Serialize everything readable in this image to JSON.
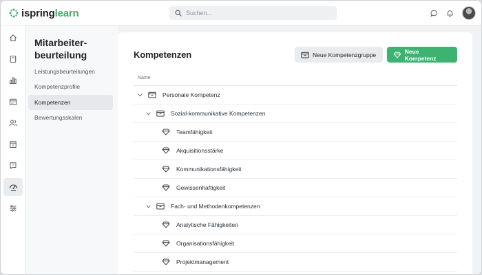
{
  "app": {
    "logo_text": "ispring",
    "logo_accent": "learn",
    "brand_color": "#3dae6b"
  },
  "search": {
    "placeholder": "Suchen..."
  },
  "topbar": {
    "icons": [
      "chat-icon",
      "bell-icon"
    ]
  },
  "rail": {
    "items": [
      {
        "icon": "home-icon"
      },
      {
        "icon": "book-icon"
      },
      {
        "icon": "bar-chart-icon"
      },
      {
        "icon": "calendar-icon"
      },
      {
        "icon": "users-icon"
      },
      {
        "icon": "calendar-day-icon"
      },
      {
        "icon": "help-chat-icon"
      },
      {
        "icon": "performance-review-icon",
        "active": true
      },
      {
        "icon": "settings-sliders-icon"
      }
    ]
  },
  "sidebar": {
    "title": "Mitarbeiter-beurteilung",
    "items": [
      {
        "label": "Leistungsbeurteilungen"
      },
      {
        "label": "Kompetenzprofile"
      },
      {
        "label": "Kompetenzen",
        "active": true
      },
      {
        "label": "Bewertungsskalen"
      }
    ]
  },
  "main": {
    "title": "Kompetenzen",
    "btn_new_group": "Neue Kompetenzgruppe",
    "btn_new_competency": "Neue Kompetenz",
    "column_name": "Name",
    "tree": [
      {
        "label": "Personale Kompetenz",
        "type": "group",
        "level": 0,
        "expanded": true
      },
      {
        "label": "Sozial-kommunikative Kompetenzen",
        "type": "group",
        "level": 1,
        "expanded": true
      },
      {
        "label": "Teamfähigkeit",
        "type": "competency",
        "level": 2
      },
      {
        "label": "Akquisitionsstärke",
        "type": "competency",
        "level": 2
      },
      {
        "label": "Kommunikationsfähigkeit",
        "type": "competency",
        "level": 2
      },
      {
        "label": "Gewissenhaftigkeit",
        "type": "competency",
        "level": 2
      },
      {
        "label": "Fach- und Methodenkompetenzen",
        "type": "group",
        "level": 1,
        "expanded": true
      },
      {
        "label": "Analytische Fähigkeiten",
        "type": "competency",
        "level": 2
      },
      {
        "label": "Organisationsfähigkeit",
        "type": "competency",
        "level": 2
      },
      {
        "label": "Projektmanagement",
        "type": "competency",
        "level": 2
      }
    ]
  }
}
